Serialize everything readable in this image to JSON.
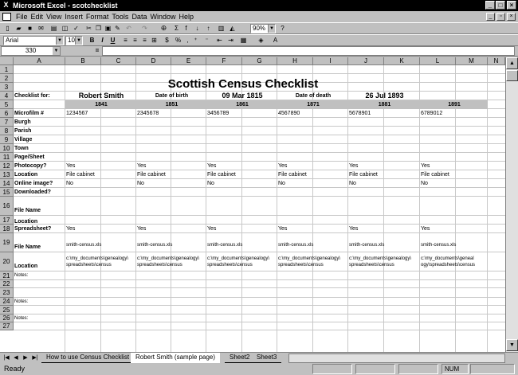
{
  "window": {
    "title": "Microsoft Excel - scotchecklist",
    "app_icon": "X"
  },
  "menu": [
    "File",
    "Edit",
    "View",
    "Insert",
    "Format",
    "Tools",
    "Data",
    "Window",
    "Help"
  ],
  "toolbar": {
    "font": "Arial",
    "size": "10",
    "zoom": "90%"
  },
  "formula_bar": {
    "name_box": "330",
    "equals": "=",
    "content": ""
  },
  "columns": [
    "A",
    "B",
    "C",
    "D",
    "E",
    "F",
    "G",
    "H",
    "I",
    "J",
    "K",
    "L",
    "M",
    "N"
  ],
  "rows": [
    "1",
    "2",
    "3",
    "4",
    "5",
    "6",
    "7",
    "8",
    "9",
    "10",
    "11",
    "12",
    "13",
    "14",
    "15",
    "16",
    "17",
    "18",
    "19",
    "20",
    "21",
    "22",
    "23",
    "24",
    "25",
    "26",
    "27"
  ],
  "sheet": {
    "title": "Scottish Census Checklist",
    "checklist_for_label": "Checklist for:",
    "name": "Robert Smith",
    "dob_label": "Date of birth",
    "dob": "09 Mar 1815",
    "dod_label": "Date of death",
    "dod": "26 Jul 1893",
    "years": [
      "1841",
      "1851",
      "1861",
      "1871",
      "1881",
      "1891"
    ],
    "row_labels": {
      "microfilm": "Microfilm #",
      "burgh": "Burgh",
      "parish": "Parish",
      "village": "Village",
      "town": "Town",
      "page_sheet": "Page/Sheet",
      "photocopy": "Photocopy?",
      "location": "Location",
      "online_image": "Online image?",
      "downloaded": "Downloaded?",
      "file_name": "File Name",
      "location2": "Location",
      "spreadsheet": "Spreadsheet?",
      "file_name2": "File Name",
      "location3": "Location",
      "notes": "Notes:"
    },
    "microfilm": [
      "1234567",
      "2345678",
      "3456789",
      "4567890",
      "5678901",
      "6789012"
    ],
    "photocopy": "Yes",
    "location_value": "File cabinet",
    "online_image": "No",
    "spreadsheet": "Yes",
    "file_names": [
      "smith-census.xls",
      "smith-census.xls",
      "smith-census.xls",
      "smith-census.xls",
      "smith-census.xls",
      "smith-census.xls"
    ],
    "paths_line1": [
      "c:\\my_documents\\genealogy\\",
      "c:\\my_documents\\genealogy\\",
      "c:\\my_documents\\genealogy\\",
      "c:\\my_documents\\genealogy\\",
      "c:\\my_documents\\genealogy\\",
      "c:\\my_documents\\geneal"
    ],
    "paths_line2": [
      "spreadsheets\\census",
      "spreadsheets\\census",
      "spreadsheets\\census",
      "spreadsheets\\census",
      "spreadsheets\\census",
      "ogy\\spreadsheets\\census"
    ]
  },
  "tabs": [
    "How to use Census Checklist",
    "Robert Smith (sample page)",
    "Sheet2",
    "Sheet3"
  ],
  "active_tab": 1,
  "status": {
    "ready": "Ready",
    "num": "NUM"
  },
  "colors": {
    "year_band": "#c0c0c0",
    "title_bar": "#000000"
  }
}
